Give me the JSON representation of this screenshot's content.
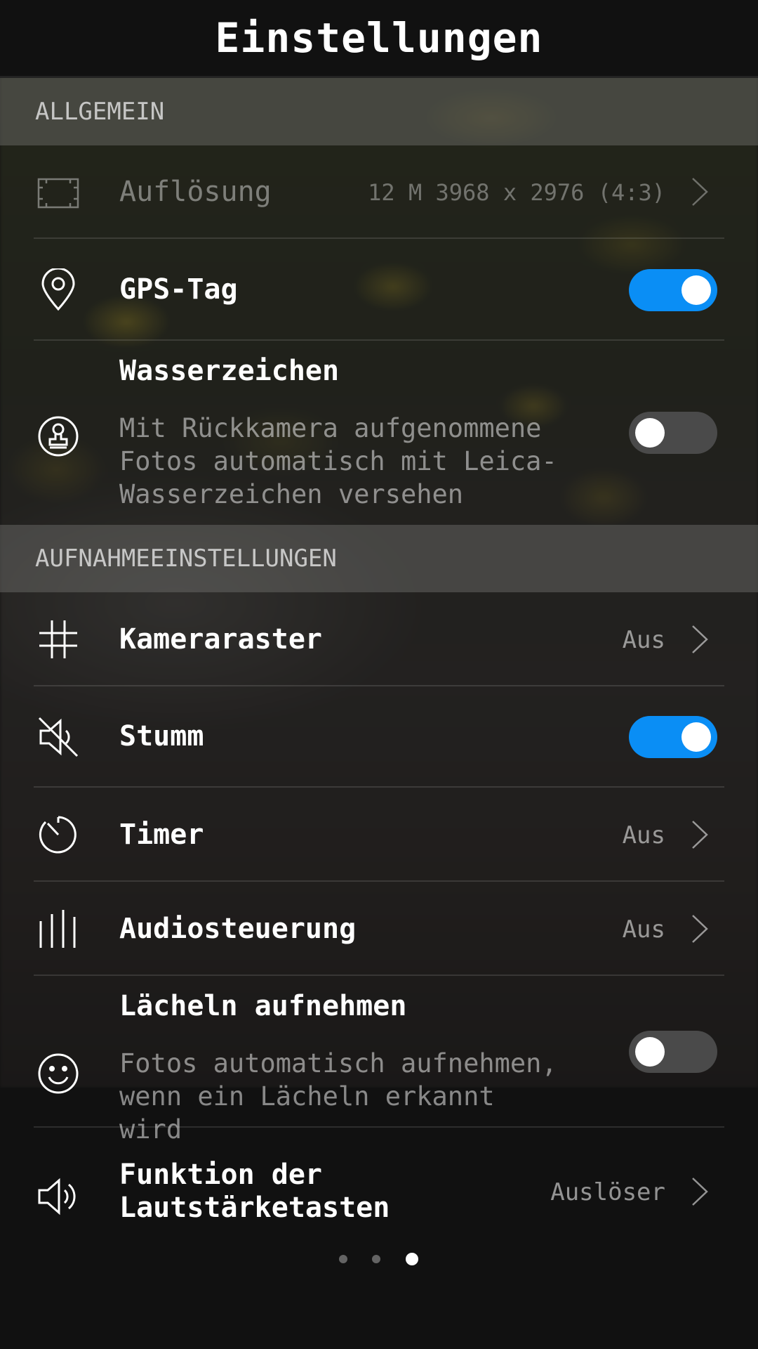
{
  "header": {
    "title": "Einstellungen"
  },
  "sections": {
    "general": {
      "label": "ALLGEMEIN"
    },
    "capture": {
      "label": "AUFNAHMEEINSTELLUNGEN"
    }
  },
  "rows": {
    "resolution": {
      "label": "Auflösung",
      "value": "12 M 3968 x 2976 (4:3)",
      "icon": "resolution-icon",
      "enabled": false
    },
    "gps_tag": {
      "label": "GPS-Tag",
      "icon": "location-pin-icon",
      "toggle_on": true
    },
    "watermark": {
      "label": "Wasserzeichen",
      "description_lines": [
        "Mit Rückkamera aufgenommene",
        "Fotos automatisch mit Leica-",
        "Wasserzeichen versehen"
      ],
      "icon": "stamp-icon",
      "toggle_on": false
    },
    "camera_grid": {
      "label": "Kameraraster",
      "value": "Aus",
      "icon": "grid-icon"
    },
    "mute": {
      "label": "Stumm",
      "icon": "speaker-muted-icon",
      "toggle_on": true
    },
    "timer": {
      "label": "Timer",
      "value": "Aus",
      "icon": "timer-icon"
    },
    "audio_control": {
      "label": "Audiosteuerung",
      "value": "Aus",
      "icon": "audio-bars-icon"
    },
    "smile_capture": {
      "label": "Lächeln aufnehmen",
      "description_lines": [
        "Fotos automatisch aufnehmen,",
        "wenn ein Lächeln erkannt wird"
      ],
      "icon": "smiley-icon",
      "toggle_on": false
    },
    "volume_keys": {
      "label_lines": [
        "Funktion der",
        "Lautstärketasten"
      ],
      "value": "Auslöser",
      "icon": "speaker-icon"
    }
  },
  "pager": {
    "pages": 3,
    "current": 3
  },
  "colors": {
    "accent": "#0a8ef5",
    "toggle_off": "#4a4a4a",
    "background": "#111111"
  }
}
